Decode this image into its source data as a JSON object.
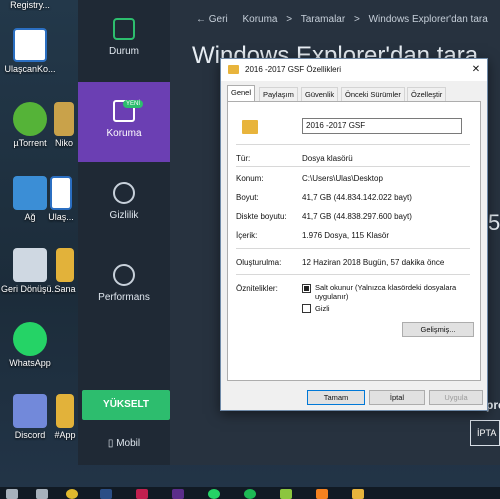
{
  "desktop": {
    "icons": [
      {
        "label": "Registry...",
        "color": "#d6dce4"
      },
      {
        "label": "UlaşcanKo...",
        "color": "#2b6fc2"
      },
      {
        "label": "µTorrent",
        "color": "#55b338"
      },
      {
        "label": "Ağ",
        "color": "#3b8ed6"
      },
      {
        "label": "Geri Dönüşü...",
        "color": "#cfd8e2"
      },
      {
        "label": "WhatsApp",
        "color": "#25d366"
      },
      {
        "label": "Discord",
        "color": "#7289da"
      },
      {
        "label": "Ulaş...",
        "color": "#2b6fc2"
      },
      {
        "label": "Niko",
        "color": "#c9a24a"
      },
      {
        "label": "Sana",
        "color": "#e2b23a"
      },
      {
        "label": "#App",
        "color": "#e2b23a"
      }
    ]
  },
  "app": {
    "nav": {
      "durum": "Durum",
      "koruma": "Koruma",
      "badge": "YENİ",
      "gizlilik": "Gizlilik",
      "performans": "Performans"
    },
    "upgrade": "YÜKSELT",
    "mobile": "Mobil",
    "breadcrumb": {
      "back": "Geri",
      "crumb1": "Koruma",
      "crumb2": "Taramalar",
      "crumb3": "Windows Explorer'dan tara",
      "sep": ">"
    },
    "title": "Windows Explorer'dan tara",
    "side_number": "5",
    "bottom_text": "pro",
    "bottom_button": "İPTA"
  },
  "dialog": {
    "title": "2016 -2017 GSF Özellikleri",
    "close": "✕",
    "tabs": [
      "Genel",
      "Paylaşım",
      "Güvenlik",
      "Önceki Sürümler",
      "Özelleştir"
    ],
    "name": "2016 -2017 GSF",
    "rows": [
      {
        "label": "Tür:",
        "value": "Dosya klasörü"
      },
      {
        "label": "Konum:",
        "value": "C:\\Users\\Ulas\\Desktop"
      },
      {
        "label": "Boyut:",
        "value": "41,7 GB (44.834.142.022 bayt)"
      },
      {
        "label": "Diskte boyutu:",
        "value": "41,7 GB (44.838.297.600 bayt)"
      },
      {
        "label": "İçerik:",
        "value": "1.976 Dosya, 115 Klasör"
      },
      {
        "label": "Oluşturulma:",
        "value": "12 Haziran 2018 Bugün, 57 dakika önce"
      }
    ],
    "attributes_label": "Öznitelikler:",
    "readonly_label": "Salt okunur (Yalnızca klasördeki dosyalara uygulanır)",
    "hidden_label": "Gizli",
    "advanced_button": "Gelişmiş...",
    "ok_button": "Tamam",
    "cancel_button": "İptal",
    "apply_button": "Uygula"
  },
  "colors": {
    "accent_purple": "#6b3fb3",
    "accent_green": "#2dbd6e",
    "folder_yellow": "#e8b43c"
  }
}
